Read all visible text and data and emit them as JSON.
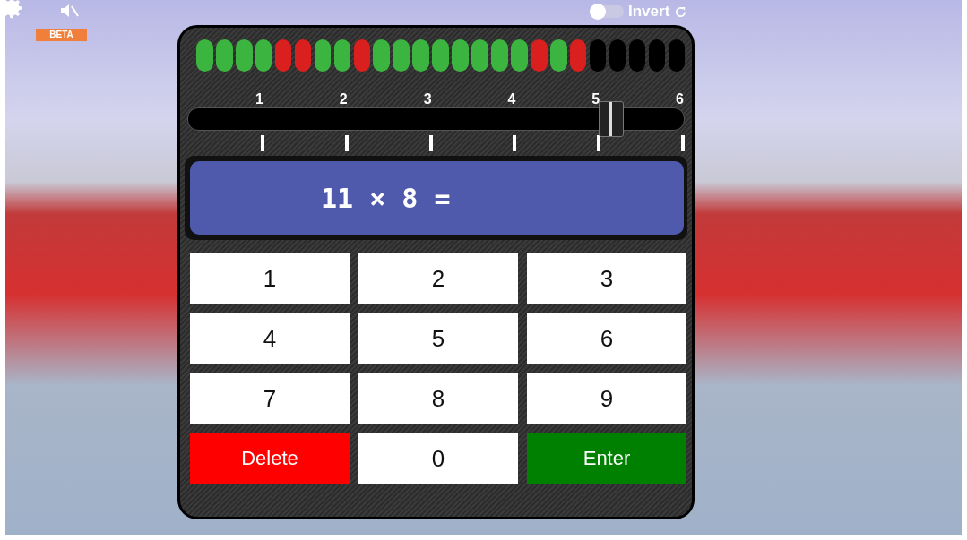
{
  "toolbar": {
    "beta_badge": "BETA",
    "invert": {
      "label": "Invert",
      "on": false
    }
  },
  "progress": [
    {
      "kind": "correct"
    },
    {
      "kind": "correct"
    },
    {
      "kind": "correct"
    },
    {
      "kind": "correct"
    },
    {
      "kind": "wrong"
    },
    {
      "kind": "wrong"
    },
    {
      "kind": "correct"
    },
    {
      "kind": "correct"
    },
    {
      "kind": "wrong"
    },
    {
      "kind": "correct"
    },
    {
      "kind": "correct"
    },
    {
      "kind": "correct"
    },
    {
      "kind": "correct"
    },
    {
      "kind": "correct"
    },
    {
      "kind": "correct"
    },
    {
      "kind": "correct"
    },
    {
      "kind": "correct"
    },
    {
      "kind": "wrong"
    },
    {
      "kind": "correct"
    },
    {
      "kind": "wrong"
    },
    {
      "kind": "empty"
    },
    {
      "kind": "empty"
    },
    {
      "kind": "empty"
    },
    {
      "kind": "empty"
    },
    {
      "kind": "empty"
    }
  ],
  "slider": {
    "labels": [
      "1",
      "2",
      "3",
      "4",
      "5",
      "6"
    ],
    "level": 0.85
  },
  "display": {
    "problem": "11 × 8 ="
  },
  "keypad": [
    {
      "label": "1",
      "kind": "digit"
    },
    {
      "label": "2",
      "kind": "digit"
    },
    {
      "label": "3",
      "kind": "digit"
    },
    {
      "label": "4",
      "kind": "digit"
    },
    {
      "label": "5",
      "kind": "digit"
    },
    {
      "label": "6",
      "kind": "digit"
    },
    {
      "label": "7",
      "kind": "digit"
    },
    {
      "label": "8",
      "kind": "digit"
    },
    {
      "label": "9",
      "kind": "digit"
    },
    {
      "label": "Delete",
      "kind": "delete"
    },
    {
      "label": "0",
      "kind": "digit"
    },
    {
      "label": "Enter",
      "kind": "enter"
    }
  ]
}
